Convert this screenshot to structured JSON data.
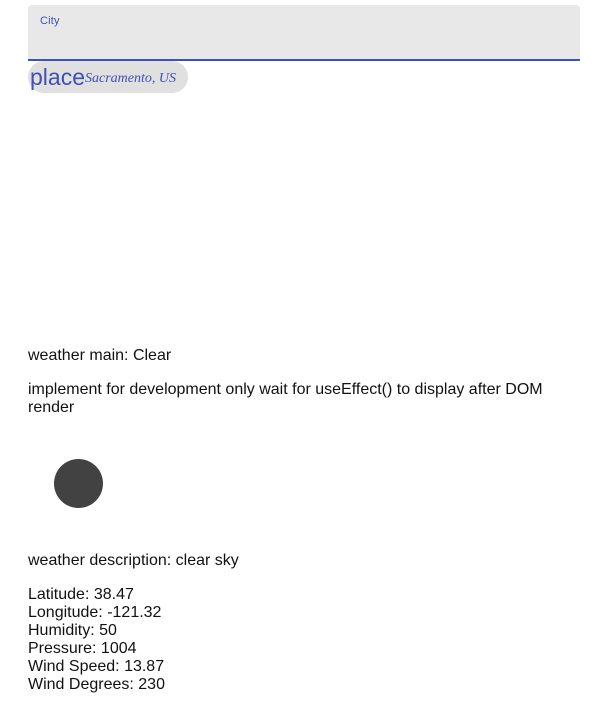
{
  "search": {
    "label": "City",
    "value": ""
  },
  "place": {
    "icon_text": "place",
    "text": "Sacramento, US"
  },
  "weather": {
    "main_label": "weather main: ",
    "main_value": "Clear",
    "dev_note": "implement for development only wait for useEffect() to display after DOM render",
    "icon": "weather-icon-circle",
    "description_label": "weather description: ",
    "description_value": "clear sky"
  },
  "stats": {
    "latitude_label": "Latitude: ",
    "latitude": "38.47",
    "longitude_label": "Longitude: ",
    "longitude": "-121.32",
    "humidity_label": "Humidity: ",
    "humidity": "50",
    "pressure_label": "Pressure: ",
    "pressure": "1004",
    "wind_speed_label": "Wind Speed: ",
    "wind_speed": "13.87",
    "wind_degrees_label": "Wind Degrees: ",
    "wind_degrees": "230"
  },
  "colors": {
    "accent": "#3f51b5",
    "field_bg": "#e8e8e8",
    "chip_bg": "#e0e0e0",
    "icon_fill": "#424242"
  }
}
